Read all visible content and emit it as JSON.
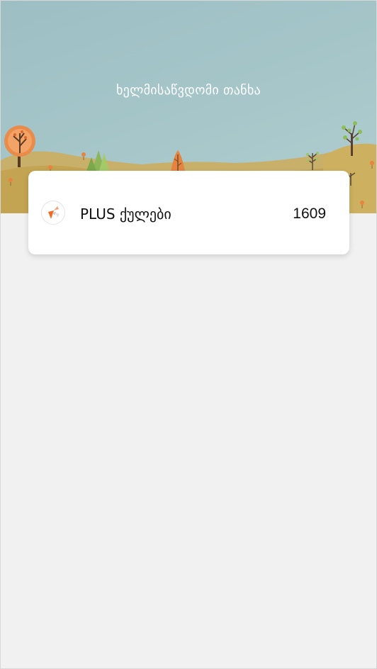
{
  "header": {
    "title": "ხელმისაწვდომი თანხა"
  },
  "balance_card": {
    "label": "PLUS ქულები",
    "value": "1609",
    "icon": "plus-points-logo-icon"
  },
  "colors": {
    "sky": "#a6c6c9",
    "hills": "#c7aa59",
    "card_bg": "#ffffff",
    "page_bg": "#f1f1f1",
    "accent_orange": "#f26a21"
  }
}
